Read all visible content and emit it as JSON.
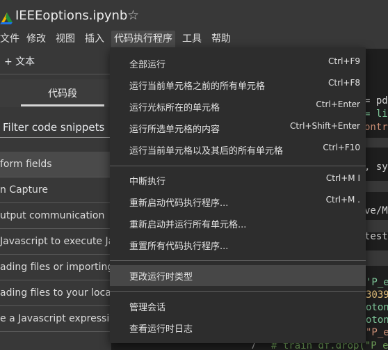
{
  "header": {
    "title": "IEEEoptions.ipynb",
    "logo_icon": "colab-logo-icon",
    "star_icon": "star-outline-icon"
  },
  "menubar": {
    "items": [
      "文件",
      "修改",
      "视图",
      "插入",
      "代码执行程序",
      "工具",
      "帮助"
    ],
    "active": "代码执行程序"
  },
  "left_panel": {
    "add_text": "+ 文本",
    "tab": "代码段",
    "filter_placeholder": "Filter code snippets",
    "snippets": [
      "form fields",
      "n Capture",
      "utput communication",
      "Javascript to execute Jav",
      "ading files or importing da",
      "ading files to your local fil",
      "e a Javascript expression"
    ]
  },
  "code_fragments": {
    "f1": "= pd",
    "f2": "= li",
    "f3": "ontr",
    "f4": ", sy",
    "f5": "ve/M",
    "f6": "test",
    "f7": "'P_e",
    "f8": "3039",
    "f9": "oton",
    "f10": "oton",
    "f11": "\"P_e",
    "line_no": "7",
    "f12": "# train_df.drop(\"P_e"
  },
  "dropdown": {
    "items": [
      {
        "label": "全部运行",
        "shortcut": "Ctrl+F9"
      },
      {
        "label": "运行当前单元格之前的所有单元格",
        "shortcut": "Ctrl+F8"
      },
      {
        "label": "运行光标所在的单元格",
        "shortcut": "Ctrl+Enter"
      },
      {
        "label": "运行所选单元格的内容",
        "shortcut": "Ctrl+Shift+Enter"
      },
      {
        "label": "运行当前单元格以及其后的所有单元格",
        "shortcut": "Ctrl+F10"
      },
      {
        "label": "中断执行",
        "shortcut": "Ctrl+M I"
      },
      {
        "label": "重新启动代码执行程序...",
        "shortcut": "Ctrl+M ."
      },
      {
        "label": "重新启动并运行所有单元格...",
        "shortcut": ""
      },
      {
        "label": "重置所有代码执行程序...",
        "shortcut": ""
      },
      {
        "label": "更改运行时类型",
        "shortcut": ""
      },
      {
        "label": "管理会话",
        "shortcut": ""
      },
      {
        "label": "查看运行时日志",
        "shortcut": ""
      }
    ],
    "highlighted": "更改运行时类型"
  },
  "colors": {
    "background": "#383838",
    "menu_bg": "#2d2d2d",
    "highlight": "#474747",
    "code_green": "#7ec699",
    "code_orange": "#ce9178"
  }
}
